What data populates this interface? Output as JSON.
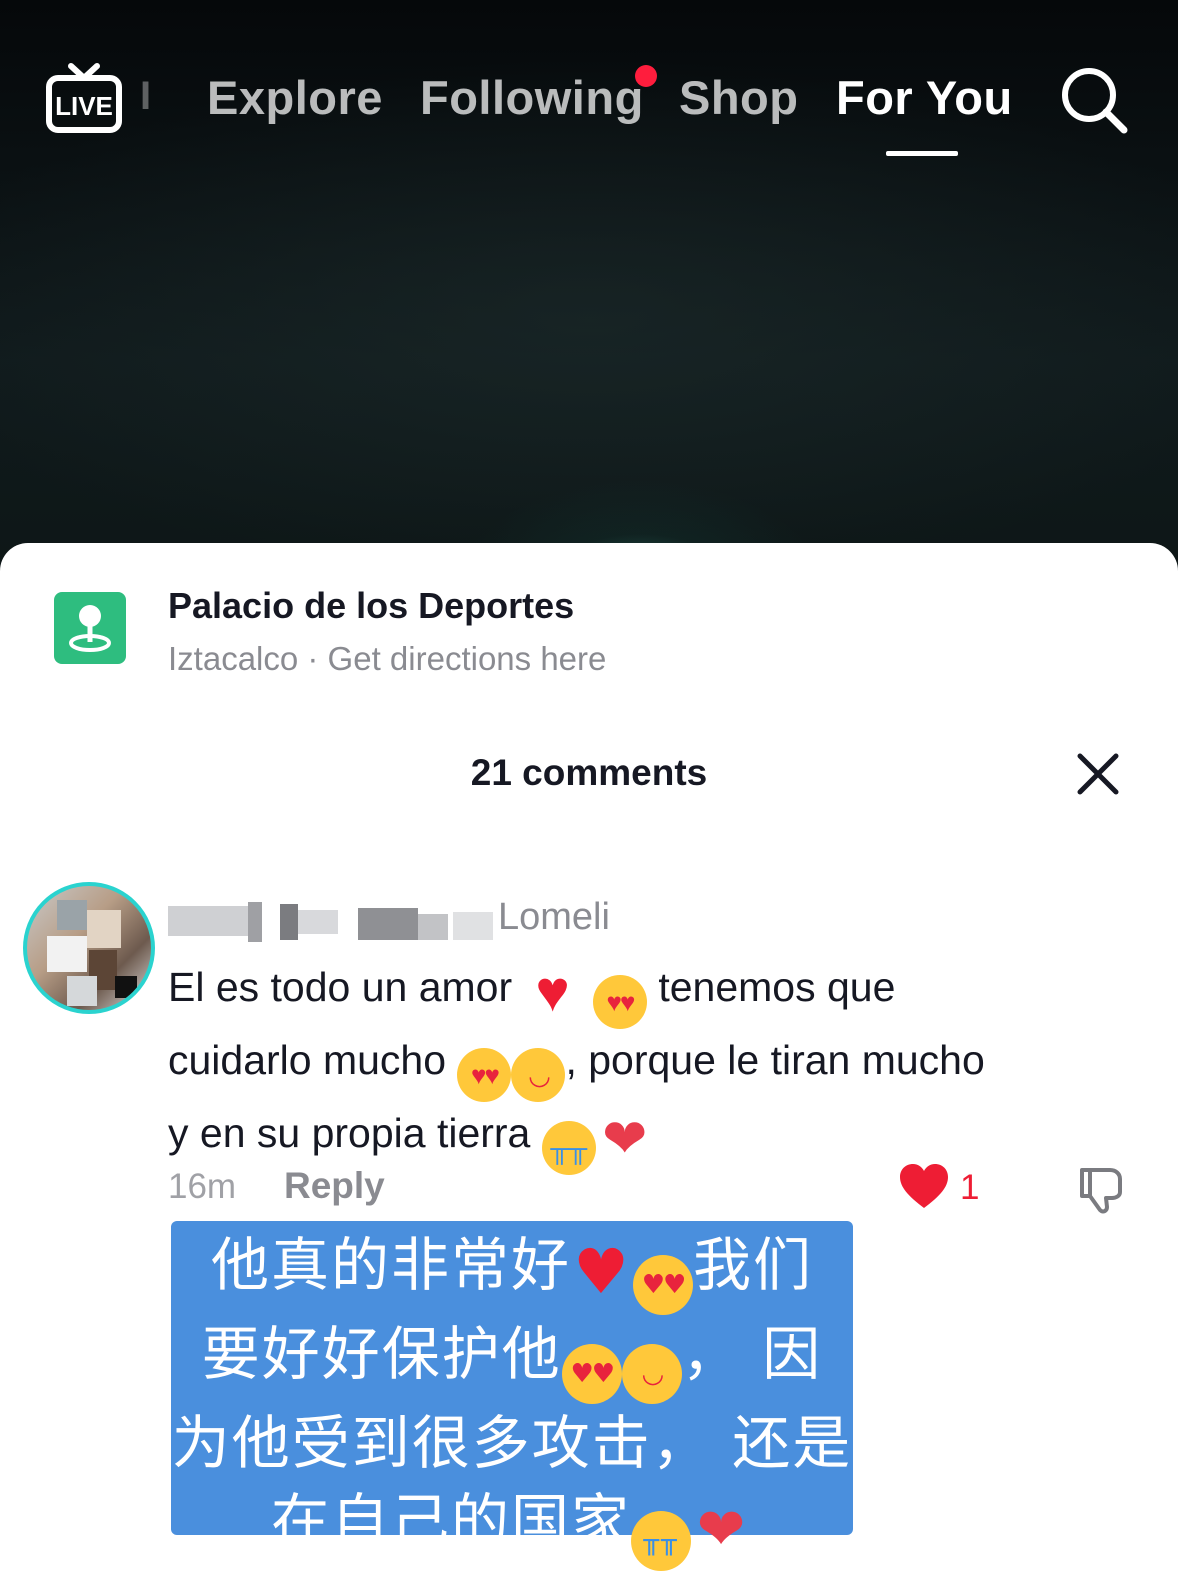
{
  "nav": {
    "live_label": "LIVE",
    "tabs": [
      {
        "label": "Explore"
      },
      {
        "label": "Following"
      },
      {
        "label": "Shop"
      },
      {
        "label": "For You",
        "active": true
      }
    ],
    "following_notification_dot": true
  },
  "location": {
    "name": "Palacio de los Deportes",
    "subtitle": "Iztacalco · Get directions here"
  },
  "comments_header": {
    "count_label": "21 comments"
  },
  "comment": {
    "username_visible": "Lomeli",
    "lines": [
      {
        "parts": [
          "El es todo un amor ",
          "♥",
          "😍",
          " tenemos que"
        ]
      },
      {
        "parts": [
          "cuidarlo mucho ",
          "😍",
          "🥰",
          ", porque le tiran mucho"
        ]
      },
      {
        "parts": [
          "y en su propia tierra ",
          "😭",
          "❤"
        ]
      }
    ],
    "time": "16m",
    "reply_label": "Reply",
    "like_count": "1"
  },
  "translation": {
    "lines": [
      {
        "parts": [
          "他真的非常好",
          "♥",
          "😍",
          "我们"
        ]
      },
      {
        "parts": [
          "要好好保护他",
          "😍",
          "🥰",
          "， 因"
        ]
      },
      {
        "parts": [
          "为他受到很多攻击， 还是"
        ]
      },
      {
        "parts": [
          "在自己的国家",
          "😭",
          "❤"
        ]
      }
    ]
  },
  "colors": {
    "accent_red": "#ee1d34",
    "location_green": "#2ebd7f",
    "translation_blue": "#4a8fdd"
  },
  "icons": [
    "live-tv-icon",
    "search-icon",
    "location-pin-icon",
    "close-icon",
    "heart-icon",
    "dislike-icon"
  ]
}
